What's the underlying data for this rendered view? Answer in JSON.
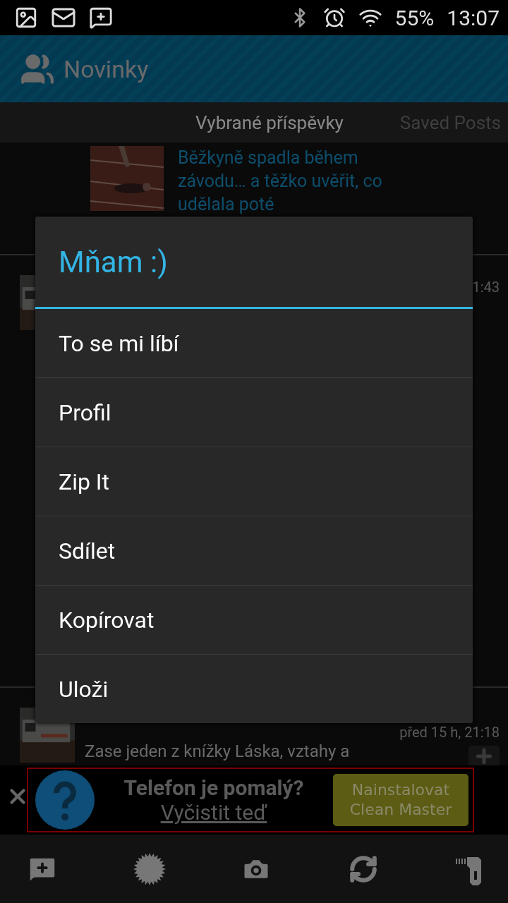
{
  "status_bar": {
    "battery": "55%",
    "time": "13:07"
  },
  "action_bar": {
    "title": "Novinky"
  },
  "tabs": [
    {
      "label": "Vybrané příspěvky",
      "selected": true
    },
    {
      "label": "Saved Posts",
      "selected": false
    }
  ],
  "feed": [
    {
      "kind": "article",
      "title": "Běžkyně spadla během závodu… a těžko uvěřit, co udělala poté"
    },
    {
      "kind": "post",
      "time": "1:43"
    },
    {
      "kind": "post",
      "time": "před 15 h, 21:18",
      "text": "Zase jeden z knížky Láska, vztahy a"
    }
  ],
  "dialog": {
    "title": "Mňam :)",
    "items": [
      "To se mi líbí",
      "Profil",
      "Zip It",
      "Sdílet",
      "Kopírovat",
      "Uloži"
    ]
  },
  "ad": {
    "headline": "Telefon je pomalý?",
    "link": "Vyčistit teď",
    "button": [
      "Nainstalovat",
      "Clean Master"
    ]
  }
}
